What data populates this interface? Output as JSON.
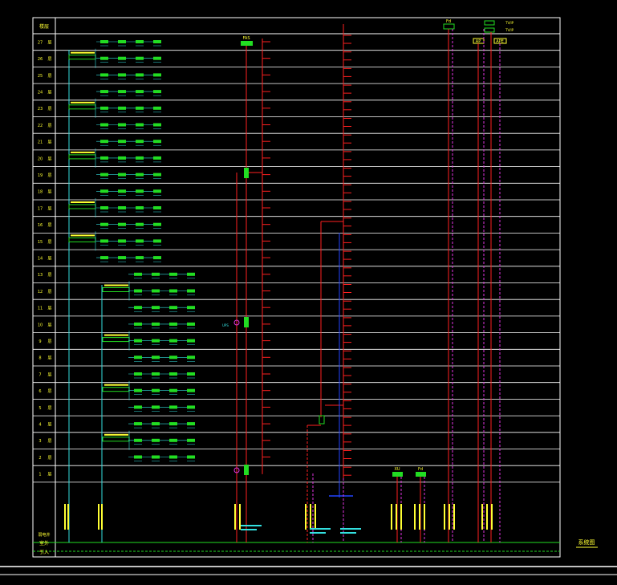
{
  "drawing": {
    "header_label": "楼层",
    "title": "系统图",
    "legend_a": "弱电井",
    "legend_b": "室外",
    "bottom_labels": [
      "室外",
      "引入"
    ]
  },
  "floors": [
    {
      "num": "27",
      "unit": "层"
    },
    {
      "num": "26",
      "unit": "层"
    },
    {
      "num": "25",
      "unit": "层"
    },
    {
      "num": "24",
      "unit": "层"
    },
    {
      "num": "23",
      "unit": "层"
    },
    {
      "num": "22",
      "unit": "层"
    },
    {
      "num": "21",
      "unit": "层"
    },
    {
      "num": "20",
      "unit": "层"
    },
    {
      "num": "19",
      "unit": "层"
    },
    {
      "num": "18",
      "unit": "层"
    },
    {
      "num": "17",
      "unit": "层"
    },
    {
      "num": "16",
      "unit": "层"
    },
    {
      "num": "15",
      "unit": "层"
    },
    {
      "num": "14",
      "unit": "层"
    },
    {
      "num": "13",
      "unit": "层"
    },
    {
      "num": "12",
      "unit": "层"
    },
    {
      "num": "11",
      "unit": "层"
    },
    {
      "num": "10",
      "unit": "层"
    },
    {
      "num": "9",
      "unit": "层"
    },
    {
      "num": "8",
      "unit": "层"
    },
    {
      "num": "7",
      "unit": "层"
    },
    {
      "num": "6",
      "unit": "层"
    },
    {
      "num": "5",
      "unit": "层"
    },
    {
      "num": "4",
      "unit": "层"
    },
    {
      "num": "3",
      "unit": "层"
    },
    {
      "num": "2",
      "unit": "层"
    },
    {
      "num": "1",
      "unit": "层"
    }
  ],
  "equipment_labels": {
    "top_center": "FAS",
    "top_right_a": "Fd",
    "top_right_b": "TV/IP",
    "top_right_c": "TV/IP",
    "ap_a": "AP",
    "ap_b": "APE",
    "bottom_a": "XU",
    "bottom_b": "Fd",
    "node_label": "UPS"
  },
  "colors": {
    "background": "#000000",
    "frame": "#ffffff",
    "riser_red": "#ff2020",
    "device_green": "#22dd22",
    "cable_cyan": "#33e0e0",
    "note_yellow": "#ffff33",
    "dash_magenta": "#e033e0",
    "bus_blue": "#2244ff"
  }
}
